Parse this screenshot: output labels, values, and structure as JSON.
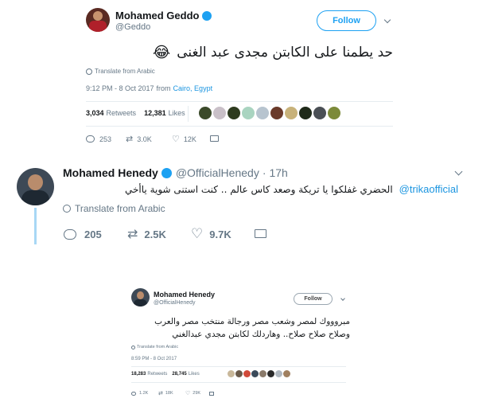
{
  "tweet1": {
    "name": "Mohamed Geddo",
    "handle": "@Geddo",
    "follow_label": "Follow",
    "text": "حد يطمنا على الكابتن مجدى عبد الغنى",
    "emoji": "😂",
    "translate_label": "Translate from Arabic",
    "timestamp": "9:12 PM - 8 Oct 2017",
    "from_label": "from",
    "location": "Cairo, Egypt",
    "retweets_count": "3,034",
    "retweets_label": "Retweets",
    "likes_count": "12,381",
    "likes_label": "Likes",
    "reply_count": "253",
    "retweet_action_count": "3.0K",
    "like_action_count": "12K",
    "liker_colors": [
      "#3b4a2a",
      "#c9c0c8",
      "#2e3b1f",
      "#a9d4c0",
      "#b7c4cf",
      "#6a3a2a",
      "#c8b27a",
      "#1f2a1a",
      "#4a4f55",
      "#7c8a3a"
    ]
  },
  "tweet2": {
    "name": "Mohamed Henedy",
    "handle": "@OfficialHenedy",
    "time": "17h",
    "mention": "@trikaofficial",
    "text": "الحضري غفلكوا يا تريكة وصعد كاس عالم .. كنت استنى شوية ياأخي",
    "translate_label": "Translate from Arabic",
    "reply_count": "205",
    "retweet_count": "2.5K",
    "like_count": "9.7K"
  },
  "embedded": {
    "name": "Mohamed Henedy",
    "handle": "@OfficialHenedy",
    "follow_label": "Follow",
    "text_line1": "مبروووك لمصر وشعب مصر ورجالة منتخب مصر والعرب",
    "text_line2": "وصلاح صلاح صلاح.. وهاردلك لكابتن مجدي عبدالغني",
    "translate_label": "Translate from Arabic",
    "timestamp": "8:59 PM - 8 Oct 2017",
    "retweets_count": "18,283",
    "retweets_label": "Retweets",
    "likes_count": "28,745",
    "likes_label": "Likes",
    "reply_count": "1.2K",
    "retweet_action_count": "18K",
    "like_action_count": "29K",
    "liker_colors": [
      "#c9b89a",
      "#6a5a4a",
      "#d04a3a",
      "#3a4a5a",
      "#8a7a6a",
      "#2a2a2a",
      "#b0b8c0",
      "#a08060"
    ]
  },
  "colors": {
    "accent": "#1da1f2",
    "link": "#1b95e0",
    "muted": "#657786",
    "thread_line": "#a8d7f5"
  }
}
